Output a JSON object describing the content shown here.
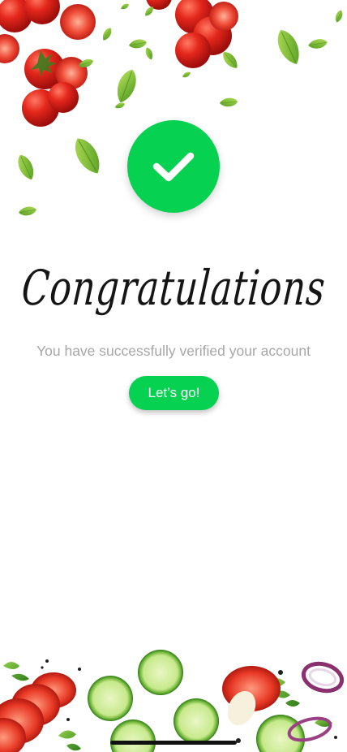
{
  "success": {
    "icon": "checkmark-icon",
    "headline": "Congratulations",
    "message": "You have successfully verified your account",
    "cta_label": "Let’s go!"
  },
  "decorations": {
    "top": "tomatoes-and-basil-leaves",
    "bottom": "sliced-vegetables"
  },
  "colors": {
    "accent_green": "#07d151",
    "message_gray": "#a7a7a7",
    "headline_black": "#151515"
  }
}
